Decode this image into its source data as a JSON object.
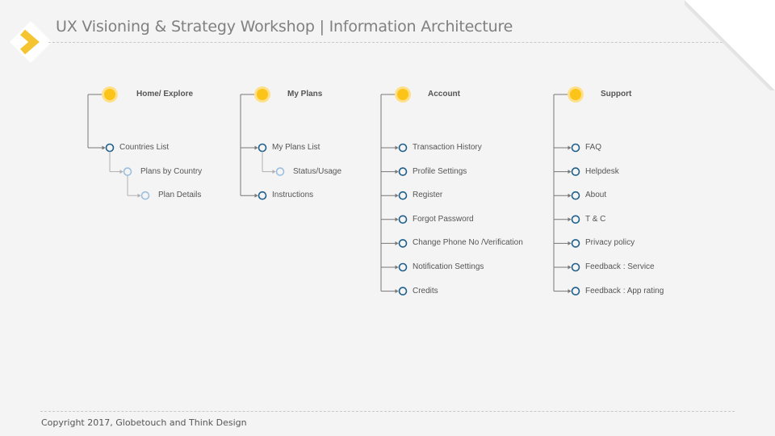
{
  "header": {
    "title": "UX Visioning & Strategy Workshop | Information Architecture"
  },
  "footer": {
    "copyright": "Copyright 2017, Globetouch and Think Design"
  },
  "colors": {
    "root_fill": "#fcc419",
    "root_ring": "#ffe08a",
    "child_ring": "#1f5f8b",
    "grandchild_ring": "#9cbfe0",
    "connector": "#777777",
    "connector_light": "#b0b0b0",
    "logo_yellow": "#f5c431"
  },
  "tree": {
    "sections": [
      {
        "name": "Home/ Explore",
        "children": [
          {
            "name": "Countries List",
            "children": [
              {
                "name": "Plans by Country",
                "children": [
                  {
                    "name": "Plan Details",
                    "children": []
                  }
                ]
              }
            ]
          }
        ]
      },
      {
        "name": "My Plans",
        "children": [
          {
            "name": "My Plans List",
            "children": [
              {
                "name": "Status/Usage",
                "children": []
              }
            ]
          },
          {
            "name": "Instructions",
            "children": []
          }
        ]
      },
      {
        "name": "Account",
        "children": [
          {
            "name": "Transaction History",
            "children": []
          },
          {
            "name": "Profile Settings",
            "children": []
          },
          {
            "name": "Register",
            "children": []
          },
          {
            "name": "Forgot Password",
            "children": []
          },
          {
            "name": "Change Phone No /Verification",
            "children": []
          },
          {
            "name": "Notification Settings",
            "children": []
          },
          {
            "name": "Credits",
            "children": []
          }
        ]
      },
      {
        "name": "Support",
        "children": [
          {
            "name": "FAQ",
            "children": []
          },
          {
            "name": "Helpdesk",
            "children": []
          },
          {
            "name": "About",
            "children": []
          },
          {
            "name": "T & C",
            "children": []
          },
          {
            "name": "Privacy policy",
            "children": []
          },
          {
            "name": "Feedback : Service",
            "children": []
          },
          {
            "name": "Feedback : App rating",
            "children": []
          }
        ]
      }
    ]
  }
}
